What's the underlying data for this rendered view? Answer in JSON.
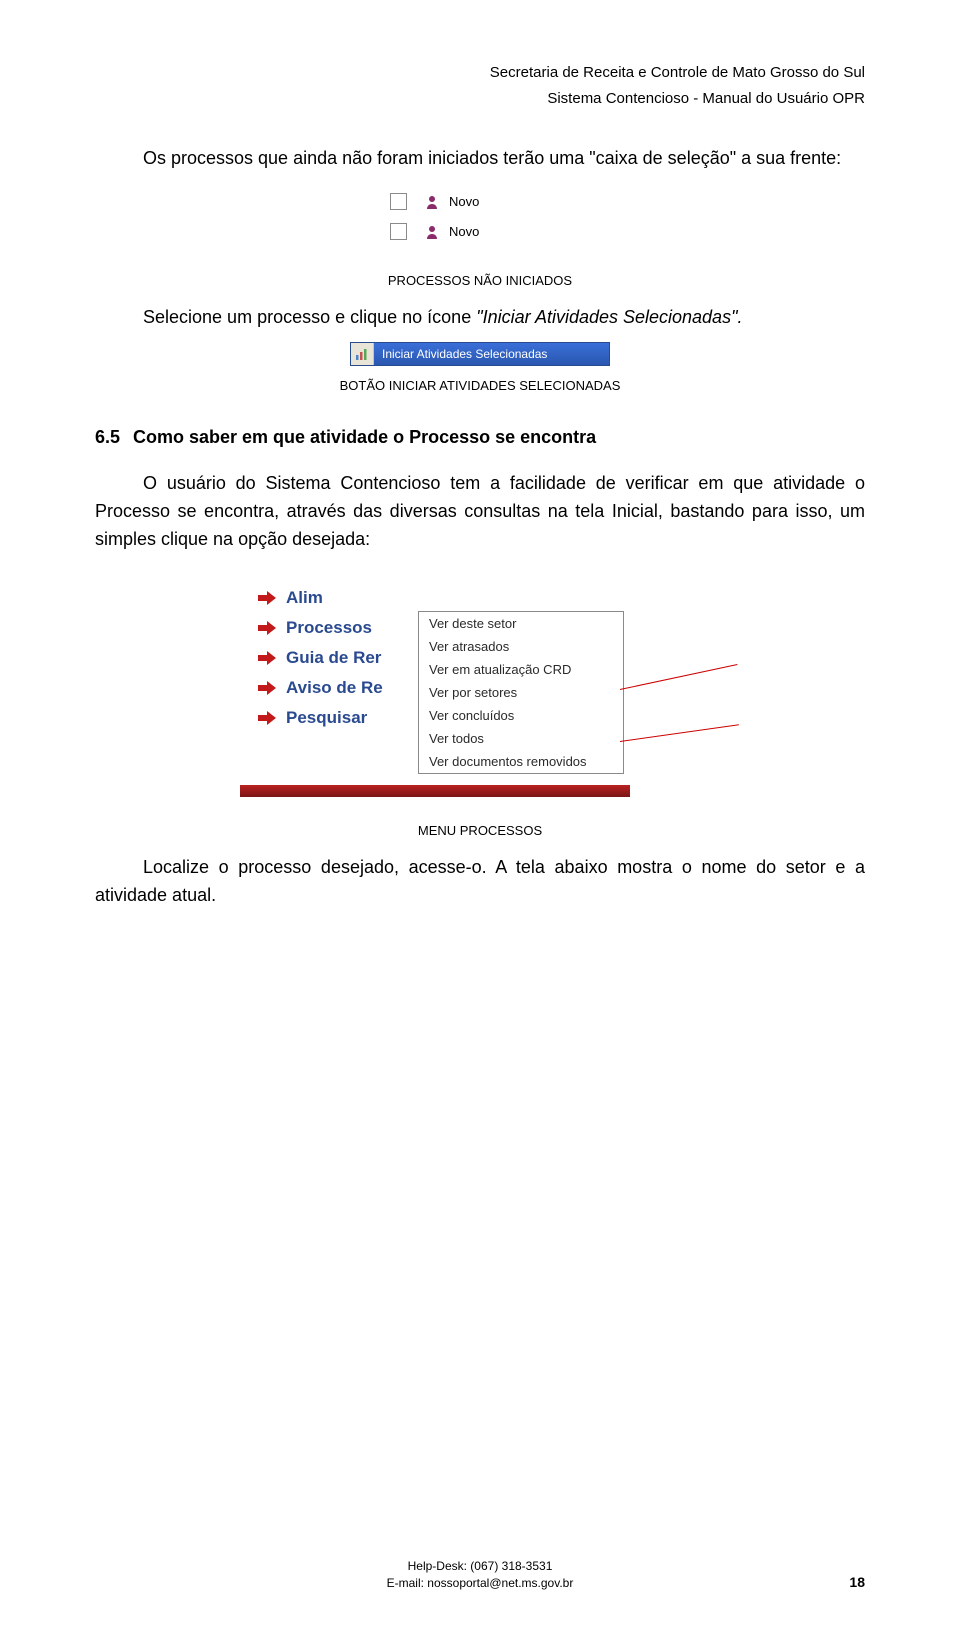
{
  "header": {
    "line1": "Secretaria de Receita e Controle de Mato Grosso do Sul",
    "line2": "Sistema Contencioso - Manual do Usuário OPR"
  },
  "intro_para": "Os processos que ainda não foram iniciados terão uma \"caixa de seleção\" a sua frente:",
  "novo_label": "Novo",
  "caption_nao_iniciados": "PROCESSOS NÃO INICIADOS",
  "instrucao_selecione_pre": "Selecione um processo e clique no ícone ",
  "instrucao_selecione_ital": "\"Iniciar Atividades Selecionadas\".",
  "btn_iniciar_label": "Iniciar Atividades Selecionadas",
  "caption_botao": "BOTÃO INICIAR ATIVIDADES SELECIONADAS",
  "section": {
    "num": "6.5",
    "title": "Como saber em que atividade o Processo se encontra"
  },
  "body_para": "O usuário do Sistema Contencioso tem a facilidade de verificar em que atividade o Processo se encontra, através das diversas consultas na tela Inicial, bastando para isso, um simples clique na opção desejada:",
  "left_menu": [
    "Alim",
    "Processos",
    "Guia de Rer",
    "Aviso de Re",
    "Pesquisar"
  ],
  "popup_items": [
    "Ver deste setor",
    "Ver atrasados",
    "Ver em atualização CRD",
    "Ver por setores",
    "Ver concluídos",
    "Ver todos",
    "Ver documentos removidos"
  ],
  "caption_menu": "MENU PROCESSOS",
  "localize_para": "Localize o processo desejado, acesse-o. A tela abaixo mostra o nome do setor e a atividade atual.",
  "footer": {
    "helpdesk": "Help-Desk: (067) 318-3531",
    "email": "E-mail: nossoportal@net.ms.gov.br"
  },
  "page_number": "18"
}
